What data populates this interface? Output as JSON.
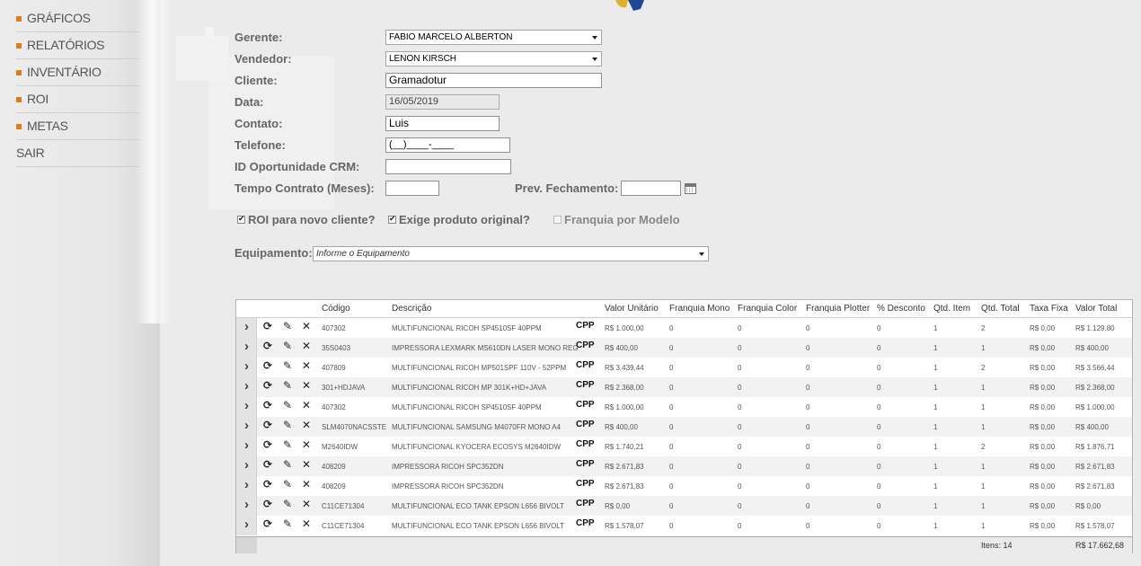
{
  "nav": [
    {
      "label": "GRÁFICOS",
      "bullet": true
    },
    {
      "label": "RELATÓRIOS",
      "bullet": true
    },
    {
      "label": "INVENTÁRIO",
      "bullet": true
    },
    {
      "label": "ROI",
      "bullet": true
    },
    {
      "label": "METAS",
      "bullet": true
    },
    {
      "label": "SAIR",
      "bullet": false
    }
  ],
  "form": {
    "gerente": {
      "label": "Gerente:",
      "value": "FABIO MARCELO ALBERTON"
    },
    "vendedor": {
      "label": "Vendedor:",
      "value": "LENON KIRSCH"
    },
    "cliente": {
      "label": "Cliente:",
      "value": "Gramadotur"
    },
    "data": {
      "label": "Data:",
      "value": "16/05/2019"
    },
    "contato": {
      "label": "Contato:",
      "value": "Luis"
    },
    "telefone": {
      "label": "Telefone:",
      "value": "(__)____-____"
    },
    "id_oportunidade": {
      "label": "ID Oportunidade CRM:",
      "value": ""
    },
    "tempo_contrato": {
      "label": "Tempo Contrato (Meses):",
      "value": ""
    },
    "prev_fechamento": {
      "label": "Prev. Fechamento:",
      "value": ""
    },
    "roi_novo_cliente": {
      "label": "ROI para novo cliente?",
      "checked": true
    },
    "exige_produto_original": {
      "label": "Exige produto original?",
      "checked": true
    },
    "franquia_por_modelo": {
      "label": "Franquia por Modelo",
      "checked": false
    },
    "equipamento": {
      "label": "Equipamento:",
      "placeholder": "Informe o Equipamento"
    }
  },
  "table": {
    "headers": {
      "codigo": "Código",
      "descricao": "Descrição",
      "valor_unitario": "Valor Unitário",
      "franquia_mono": "Franquia Mono",
      "franquia_color": "Franquia Color",
      "franquia_plotter": "Franquia Plotter",
      "desconto": "% Desconto",
      "qtd_item": "Qtd. Item",
      "qtd_total": "Qtd. Total",
      "taxa_fixa": "Taxa Fixa",
      "valor_total": "Valor Total"
    },
    "rows": [
      {
        "codigo": "407302",
        "descricao": "MULTIFUNCIONAL RICOH SP4510SF 40PPM",
        "tipo": "CPP",
        "valor_unitario": "R$ 1.000,00",
        "franquia_mono": "0",
        "franquia_color": "0",
        "franquia_plotter": "0",
        "desconto": "0",
        "qtd_item": "1",
        "qtd_total": "2",
        "taxa_fixa": "R$ 0,00",
        "valor_total": "R$ 1.129,80"
      },
      {
        "codigo": "35S0403",
        "descricao": "IMPRESSORA LEXMARK MS610DN LASER MONO REG",
        "tipo": "CPP",
        "valor_unitario": "R$ 400,00",
        "franquia_mono": "0",
        "franquia_color": "0",
        "franquia_plotter": "0",
        "desconto": "0",
        "qtd_item": "1",
        "qtd_total": "1",
        "taxa_fixa": "R$ 0,00",
        "valor_total": "R$ 400,00"
      },
      {
        "codigo": "407809",
        "descricao": "MULTIFUNCIONAL RICOH MP501SPF 110V - 52PPM",
        "tipo": "CPP",
        "valor_unitario": "R$ 3.439,44",
        "franquia_mono": "0",
        "franquia_color": "0",
        "franquia_plotter": "0",
        "desconto": "0",
        "qtd_item": "1",
        "qtd_total": "2",
        "taxa_fixa": "R$ 0,00",
        "valor_total": "R$ 3.566,44"
      },
      {
        "codigo": "301+HDJAVA",
        "descricao": "MULTIFUNCIONAL RICOH MP 301K+HD+JAVA",
        "tipo": "CPP",
        "valor_unitario": "R$ 2.368,00",
        "franquia_mono": "0",
        "franquia_color": "0",
        "franquia_plotter": "0",
        "desconto": "0",
        "qtd_item": "1",
        "qtd_total": "1",
        "taxa_fixa": "R$ 0,00",
        "valor_total": "R$ 2.368,00"
      },
      {
        "codigo": "407302",
        "descricao": "MULTIFUNCIONAL RICOH SP4510SF 40PPM",
        "tipo": "CPP",
        "valor_unitario": "R$ 1.000,00",
        "franquia_mono": "0",
        "franquia_color": "0",
        "franquia_plotter": "0",
        "desconto": "0",
        "qtd_item": "1",
        "qtd_total": "1",
        "taxa_fixa": "R$ 0,00",
        "valor_total": "R$ 1.000,00"
      },
      {
        "codigo": "SLM4070NACSSTE",
        "descricao": "MULTIFUNCIONAL SAMSUNG M4070FR MONO A4",
        "tipo": "CPP",
        "valor_unitario": "R$ 400,00",
        "franquia_mono": "0",
        "franquia_color": "0",
        "franquia_plotter": "0",
        "desconto": "0",
        "qtd_item": "1",
        "qtd_total": "1",
        "taxa_fixa": "R$ 0,00",
        "valor_total": "R$ 400,00"
      },
      {
        "codigo": "M2640IDW",
        "descricao": "MULTIFUNCIONAL KYOCERA ECOSYS M2640IDW",
        "tipo": "CPP",
        "valor_unitario": "R$ 1.740,21",
        "franquia_mono": "0",
        "franquia_color": "0",
        "franquia_plotter": "0",
        "desconto": "0",
        "qtd_item": "1",
        "qtd_total": "2",
        "taxa_fixa": "R$ 0,00",
        "valor_total": "R$ 1.876,71"
      },
      {
        "codigo": "408209",
        "descricao": "IMPRESSORA RICOH SPC352DN",
        "tipo": "CPP",
        "valor_unitario": "R$ 2.671,83",
        "franquia_mono": "0",
        "franquia_color": "0",
        "franquia_plotter": "0",
        "desconto": "0",
        "qtd_item": "1",
        "qtd_total": "1",
        "taxa_fixa": "R$ 0,00",
        "valor_total": "R$ 2.671,83"
      },
      {
        "codigo": "408209",
        "descricao": "IMPRESSORA RICOH SPC352DN",
        "tipo": "CPP",
        "valor_unitario": "R$ 2.671,83",
        "franquia_mono": "0",
        "franquia_color": "0",
        "franquia_plotter": "0",
        "desconto": "0",
        "qtd_item": "1",
        "qtd_total": "1",
        "taxa_fixa": "R$ 0,00",
        "valor_total": "R$ 2.671,83"
      },
      {
        "codigo": "C11CE71304",
        "descricao": "MULTIFUNCIONAL ECO TANK EPSON L656 BIVOLT",
        "tipo": "CPP",
        "valor_unitario": "R$ 0,00",
        "franquia_mono": "0",
        "franquia_color": "0",
        "franquia_plotter": "0",
        "desconto": "0",
        "qtd_item": "1",
        "qtd_total": "1",
        "taxa_fixa": "R$ 0,00",
        "valor_total": "R$ 0,00"
      },
      {
        "codigo": "C11CE71304",
        "descricao": "MULTIFUNCIONAL ECO TANK EPSON L656 BIVOLT",
        "tipo": "CPP",
        "valor_unitario": "R$ 1.578,07",
        "franquia_mono": "0",
        "franquia_color": "0",
        "franquia_plotter": "0",
        "desconto": "0",
        "qtd_item": "1",
        "qtd_total": "1",
        "taxa_fixa": "R$ 0,00",
        "valor_total": "R$ 1.578,07"
      }
    ],
    "footer": {
      "itens": "Itens: 14",
      "total": "R$ 17.662,68"
    }
  },
  "icons": {
    "expand": "chevron-right-icon",
    "refresh": "refresh-icon",
    "edit": "pencil-icon",
    "delete": "close-icon",
    "calendar": "calendar-icon",
    "dropdown": "caret-down-icon"
  },
  "colors": {
    "accent": "#e07b20",
    "background": "#ebebeb"
  }
}
